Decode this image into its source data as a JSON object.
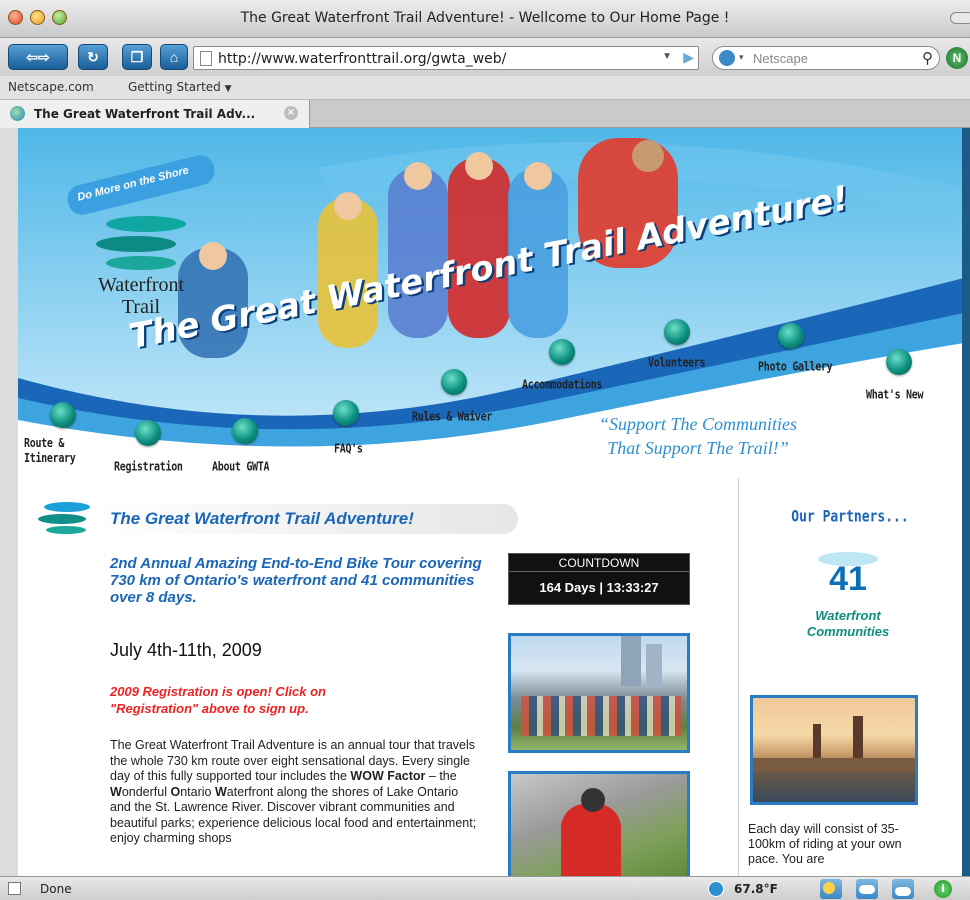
{
  "window": {
    "title": "The Great Waterfront Trail Adventure! - Wellcome to Our Home Page !"
  },
  "toolbar": {
    "url": "http://www.waterfronttrail.org/gwta_web/",
    "search_placeholder": "Netscape"
  },
  "bookmarks": [
    {
      "label": "Netscape.com"
    },
    {
      "label": "Getting Started"
    }
  ],
  "tab": {
    "label": "The Great Waterfront Trail Adv..."
  },
  "status": {
    "text": "Done",
    "weather": "67.8°F"
  },
  "site": {
    "logo": {
      "tagline": "Do More on the Shore",
      "name": "Waterfront Trail"
    },
    "banner_title": "The Great Waterfront Trail Adventure!",
    "nav": [
      {
        "label": "Route & Itinerary"
      },
      {
        "label": "Registration"
      },
      {
        "label": "About GWTA"
      },
      {
        "label": "FAQ's"
      },
      {
        "label": "Rules & Waiver"
      },
      {
        "label": "Accommodations"
      },
      {
        "label": "Volunteers"
      },
      {
        "label": "Photo Gallery"
      },
      {
        "label": "What's New"
      }
    ],
    "slogan_line1": "“Support The Communities",
    "slogan_line2": "That Support The Trail!”",
    "heading": "The Great Waterfront Trail Adventure!",
    "subtitle": "2nd Annual Amazing End-to-End Bike Tour covering 730 km of Ontario's waterfront and 41 communities over 8 days.",
    "dates": "July 4th-11th, 2009",
    "registration_note": "2009 Registration is open! Click on \"Registration\" above to sign up.",
    "body_html_parts": {
      "p1": "The Great Waterfront Trail Adventure is an annual tour that travels the whole 730 km route over eight sensational days. Every single day of this fully supported tour includes the ",
      "wow": "WOW Factor",
      "p2": " – the ",
      "w1": "W",
      "p3": "onderful ",
      "o1": "O",
      "p4": "ntario ",
      "w2": "W",
      "p5": "aterfront along the shores of Lake Ontario and the St. Lawrence River. Discover vibrant communities and beautiful parks; experience delicious local food and entertainment; enjoy charming shops"
    },
    "countdown": {
      "label": "COUNTDOWN",
      "value": "164 Days | 13:33:27"
    },
    "partners": {
      "title": "Our Partners...",
      "count": "41",
      "line1": "Waterfront",
      "line2": "Communities"
    },
    "sidebar_text": "Each day will consist of 35-100km of riding at your own pace. You are"
  },
  "colors": {
    "brand_blue": "#1a66b8",
    "teal": "#0c8f7f",
    "alert_red": "#ee2222"
  }
}
